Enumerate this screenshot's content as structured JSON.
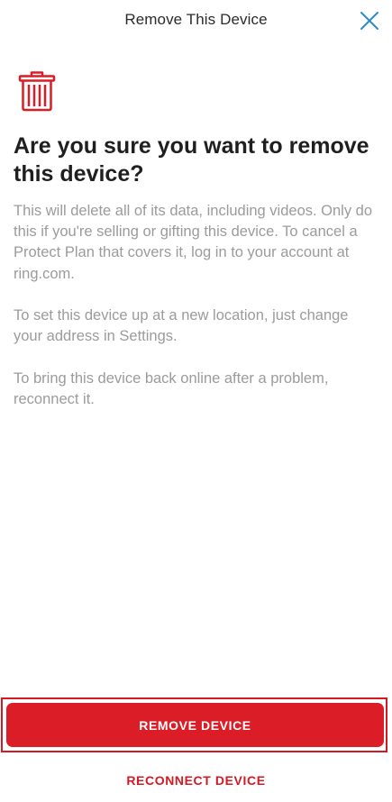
{
  "header": {
    "title": "Remove This Device"
  },
  "content": {
    "heading": "Are you sure you want to remove this device?",
    "paragraphs": [
      "This will delete all of its data, including videos. Only do this if you're selling or gifting this device. To cancel a Protect Plan that covers it, log in to your account at ring.com.",
      "To set this device up at a new location, just change your address in Settings.",
      "To bring this device back online after a problem, reconnect it."
    ]
  },
  "actions": {
    "remove_label": "REMOVE DEVICE",
    "reconnect_label": "RECONNECT DEVICE"
  },
  "icons": {
    "close": "close-icon",
    "trash": "trash-icon"
  },
  "colors": {
    "accent_red": "#da1d26",
    "close_blue": "#2e8bc6",
    "heading_text": "#1f1f1f",
    "body_text": "#9b9b9b"
  }
}
